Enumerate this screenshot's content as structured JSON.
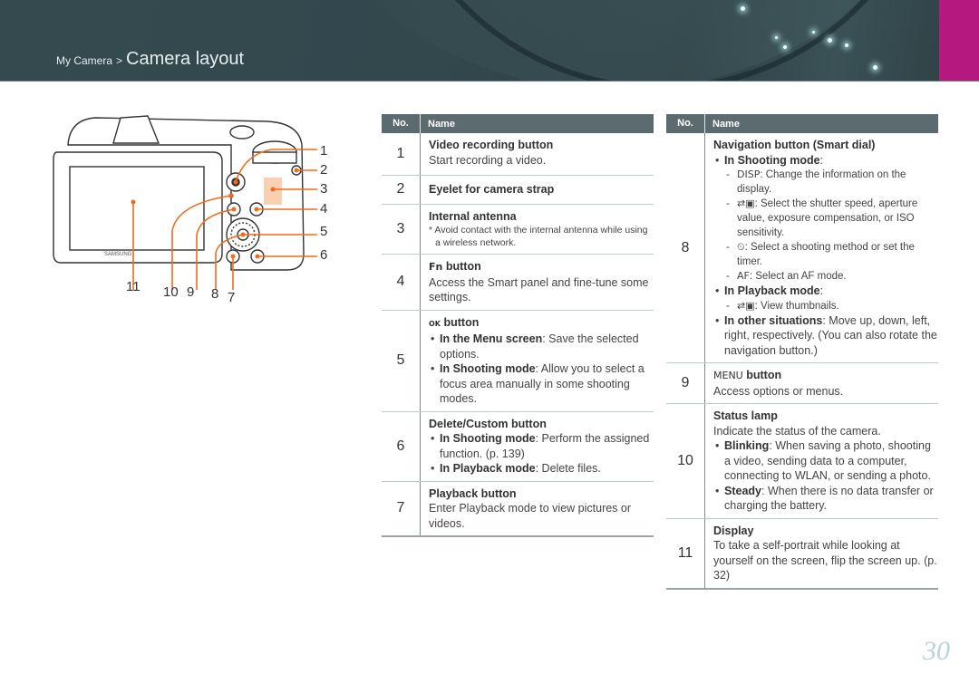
{
  "header": {
    "breadcrumb_parent": "My Camera",
    "breadcrumb_separator": ">",
    "breadcrumb_current": "Camera layout",
    "accent_color": "#b5197f"
  },
  "illustration": {
    "brand_label": "SAMSUNG",
    "callouts": [
      "1",
      "2",
      "3",
      "4",
      "5",
      "6",
      "7",
      "8",
      "9",
      "10",
      "11"
    ],
    "callout_color": "#f26b1d"
  },
  "table_headers": {
    "no": "No.",
    "name": "Name"
  },
  "left_table": [
    {
      "no": "1",
      "title": "Video recording button",
      "desc": "Start recording a video."
    },
    {
      "no": "2",
      "title": "Eyelet for camera strap"
    },
    {
      "no": "3",
      "title": "Internal antenna",
      "note": "* Avoid contact with the internal antenna while using a wireless network."
    },
    {
      "no": "4",
      "title_icon": "Fn",
      "title": "button",
      "desc": "Access the Smart panel and fine-tune some settings."
    },
    {
      "no": "5",
      "title_icon": "OK",
      "title": "button",
      "bullets": [
        {
          "bold": "In the Menu screen",
          "text": ": Save the selected options."
        },
        {
          "bold": "In Shooting mode",
          "text": ": Allow you to select a focus area manually in some shooting modes."
        }
      ]
    },
    {
      "no": "6",
      "title": "Delete/Custom button",
      "bullets": [
        {
          "bold": "In Shooting mode",
          "text": ": Perform the assigned function. (p. 139)"
        },
        {
          "bold": "In Playback mode",
          "text": ": Delete files."
        }
      ]
    },
    {
      "no": "7",
      "title": "Playback button",
      "desc": "Enter Playback mode to view pictures or videos."
    }
  ],
  "right_table": {
    "row8": {
      "no": "8",
      "title": "Navigation button (Smart dial)",
      "shooting_bold": "In Shooting mode",
      "shooting_tail": ":",
      "shooting_items": [
        {
          "key": "DISP",
          "text": ": Change the information on the display."
        },
        {
          "key": "⇄▣",
          "text": ": Select the shutter speed, aperture value, exposure compensation, or ISO sensitivity."
        },
        {
          "key": "⏲",
          "text": ": Select a shooting method or set the timer."
        },
        {
          "key": "AF",
          "text": ": Select an AF mode."
        }
      ],
      "playback_bold": "In Playback mode",
      "playback_tail": ":",
      "playback_items": [
        {
          "key": "⇄▣",
          "text": ": View thumbnails."
        }
      ],
      "other_bold": "In other situations",
      "other_text": ": Move up, down, left, right, respectively. (You can also rotate the navigation button.)"
    },
    "row9": {
      "no": "9",
      "title_icon": "MENU",
      "title": "button",
      "desc": "Access options or menus."
    },
    "row10": {
      "no": "10",
      "title": "Status lamp",
      "desc": "Indicate the status of the camera.",
      "bullets": [
        {
          "bold": "Blinking",
          "text": ": When saving a photo, shooting a video, sending data to a computer, connecting to WLAN, or sending a photo."
        },
        {
          "bold": "Steady",
          "text": ": When there is no data transfer or charging the battery."
        }
      ]
    },
    "row11": {
      "no": "11",
      "title": "Display",
      "desc": "To take a self-portrait while looking at yourself on the screen, flip the screen up. (p. 32)"
    }
  },
  "page_number": "30"
}
